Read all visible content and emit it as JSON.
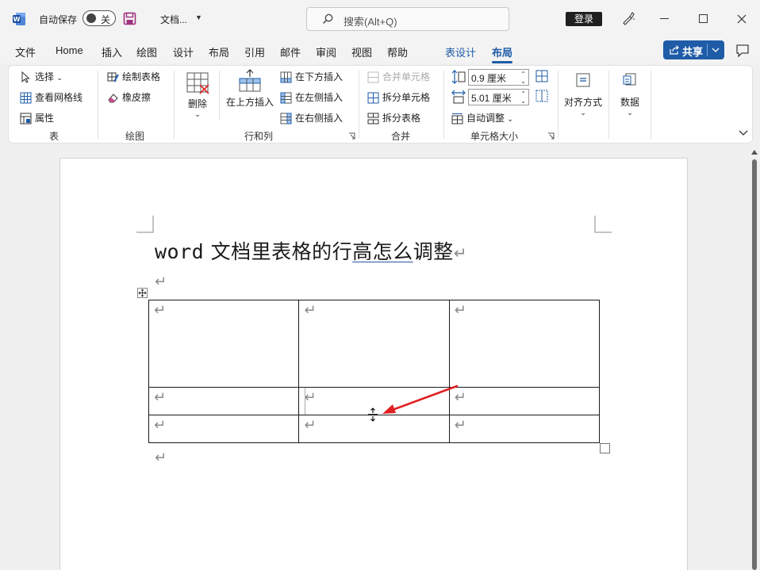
{
  "titlebar": {
    "autosave_label": "自动保存",
    "autosave_state": "关",
    "doc_name": "文档...",
    "search_placeholder": "搜索(Alt+Q)",
    "login_label": "登录"
  },
  "menu": {
    "tabs": [
      "文件",
      "Home",
      "插入",
      "绘图",
      "设计",
      "布局",
      "引用",
      "邮件",
      "审阅",
      "视图",
      "帮助"
    ],
    "context_tabs": [
      "表设计",
      "布局"
    ],
    "active_tab": "布局",
    "share_label": "共享"
  },
  "ribbon": {
    "table_group": {
      "label": "表",
      "select": "选择",
      "view_gridlines": "查看网格线",
      "properties": "属性"
    },
    "draw_group": {
      "label": "绘图",
      "draw_table": "绘制表格",
      "eraser": "橡皮擦"
    },
    "rows_cols_group": {
      "label": "行和列",
      "delete": "删除",
      "insert_above": "在上方插入",
      "insert_below": "在下方插入",
      "insert_left": "在左侧插入",
      "insert_right": "在右侧插入"
    },
    "merge_group": {
      "label": "合并",
      "merge_cells": "合并单元格",
      "split_cells": "拆分单元格",
      "split_table": "拆分表格"
    },
    "cell_size_group": {
      "label": "单元格大小",
      "height_value": "0.9 厘米",
      "width_value": "5.01 厘米",
      "autofit": "自动调整"
    },
    "alignment": "对齐方式",
    "data": "数据"
  },
  "document": {
    "title_latin": "word",
    "title_text_1": " 文档里表格的行",
    "title_text_underlined": "高怎么",
    "title_text_2": "调整",
    "paragraph_mark": "↵"
  },
  "colors": {
    "accent": "#1f5ca8",
    "arrow": "#e02020",
    "login_bg": "#1f1f1f"
  }
}
